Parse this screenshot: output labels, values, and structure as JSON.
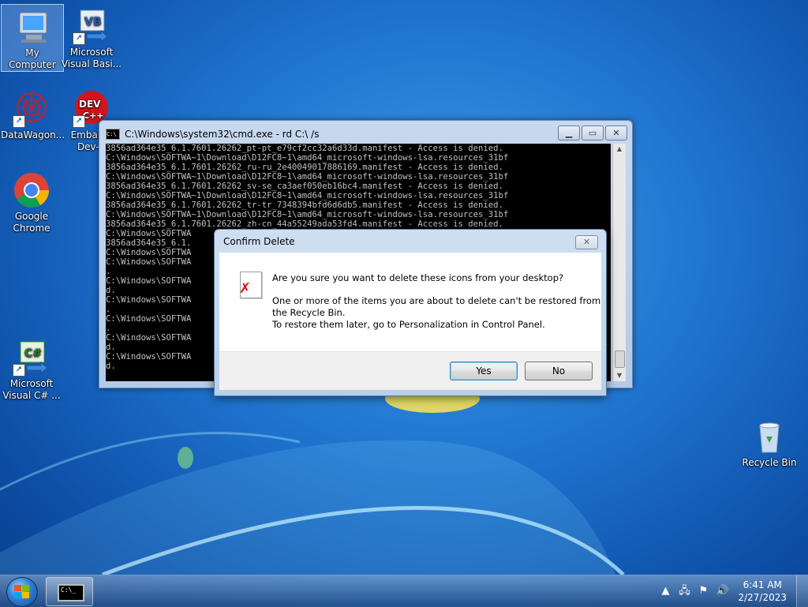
{
  "desktop_icons": [
    {
      "label": "My Computer",
      "icon": "computer-icon"
    },
    {
      "label": "Microsoft Visual Basi...",
      "icon": "visual-basic-icon"
    },
    {
      "label": "DataWagon...",
      "icon": "datawagon-icon"
    },
    {
      "label": "Embarca Dev-C",
      "icon": "dev-cpp-icon"
    },
    {
      "label": "Google Chrome",
      "icon": "chrome-icon"
    },
    {
      "label": "Microsoft Visual C# ...",
      "icon": "visual-csharp-icon"
    },
    {
      "label": "Recycle Bin",
      "icon": "recycle-bin-icon"
    }
  ],
  "cmd_window": {
    "title": "C:\\Windows\\system32\\cmd.exe - rd  C:\\ /s",
    "lines": [
      "3856ad364e35_6.1.7601.26262_pt-pt_e79cf2cc32a6d33d.manifest - Access is denied.",
      "C:\\Windows\\SOFTWA~1\\Download\\D12FC8~1\\amd64_microsoft-windows-lsa.resources_31bf",
      "3856ad364e35_6.1.7601.26262_ru-ru_2e40049017886169.manifest - Access is denied.",
      "C:\\Windows\\SOFTWA~1\\Download\\D12FC8~1\\amd64_microsoft-windows-lsa.resources_31bf",
      "3856ad364e35_6.1.7601.26262_sv-se_ca3aef050eb16bc4.manifest - Access is denied.",
      "C:\\Windows\\SOFTWA~1\\Download\\D12FC8~1\\amd64_microsoft-windows-lsa.resources_31bf",
      "3856ad364e35_6.1.7601.26262_tr-tr_7348394bfd6d6db5.manifest - Access is denied.",
      "C:\\Windows\\SOFTWA~1\\Download\\D12FC8~1\\amd64_microsoft-windows-lsa.resources_31bf",
      "3856ad364e35_6.1.7601.26262_zh-cn_44a55249ada53fd4.manifest - Access is denied.",
      "C:\\Windows\\SOFTWA",
      "3856ad364e35_6.1.",
      "C:\\Windows\\SOFTWA",
      "C:\\Windows\\SOFTWA",
      ".",
      "C:\\Windows\\SOFTWA",
      "d.",
      "C:\\Windows\\SOFTWA",
      ".",
      "C:\\Windows\\SOFTWA",
      ".",
      "C:\\Windows\\SOFTWA",
      "d.",
      "C:\\Windows\\SOFTWA",
      "d."
    ]
  },
  "dialog": {
    "title": "Confirm Delete",
    "question": "Are you sure you want to delete these icons from your desktop?",
    "detail_1": "One or more of the items you are about to delete can't be restored from",
    "detail_2": "the Recycle Bin.",
    "detail_3": "To restore them later, go to Personalization in Control Panel.",
    "yes_label": "Yes",
    "no_label": "No"
  },
  "taskbar": {
    "time": "6:41 AM",
    "date": "2/27/2023",
    "cmd_item_label": "C:\\_"
  }
}
